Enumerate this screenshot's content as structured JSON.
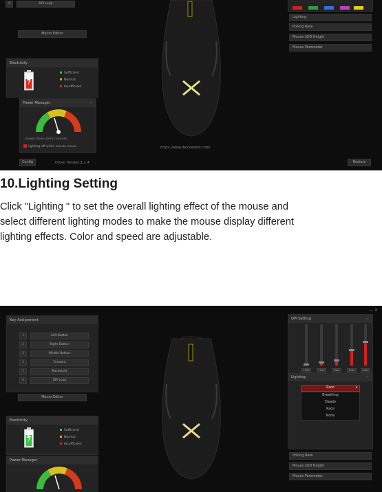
{
  "shot1": {
    "key_row": {
      "num": "6",
      "label": "DPI Loop"
    },
    "macro_editor": "Macro Editor",
    "electricity": {
      "title": "Electricity",
      "legend": [
        {
          "label": "Sufficient",
          "color": "#2ecc40"
        },
        {
          "label": "Normal",
          "color": "#e8a010"
        },
        {
          "label": "Insufficient",
          "color": "#e02020"
        }
      ]
    },
    "power_manager": {
      "title": "Power Manager",
      "minus": "—",
      "power_down": "power down (ten) minutes",
      "lighting_off": "lighting off while mouse move"
    },
    "footer": {
      "config": "Config",
      "driver_version": "Driver Version:1.1.4",
      "url": "https://www.delcoworld.com/",
      "restore": "Restore"
    },
    "right_panel": {
      "swatches": [
        "#d42020",
        "#2ea03a",
        "#3070e0",
        "#c040c0",
        "#e0d020"
      ],
      "items": [
        "Lighting",
        "Polling Rate",
        "Mouse LOD Height",
        "Mouse Parameter"
      ]
    }
  },
  "doc": {
    "title": "10.Lighting Setting",
    "line1": "Click \"Lighting \" to set the overall lighting effect of the mouse and",
    "line2": "select different lighting modes to make the mouse display different",
    "line3": "lighting effects. Color and speed are adjustable."
  },
  "shot2": {
    "window_controls": "— ✕",
    "key_assignment": {
      "title": "Key Assignment",
      "rows": [
        {
          "num": "1",
          "label": "Left Button"
        },
        {
          "num": "2",
          "label": "Right Button"
        },
        {
          "num": "3",
          "label": "Middle Button"
        },
        {
          "num": "4",
          "label": "Forward"
        },
        {
          "num": "5",
          "label": "Backward"
        },
        {
          "num": "6",
          "label": "DPI Loop"
        }
      ]
    },
    "macro_editor": "Macro Editor",
    "electricity": {
      "title": "Electricity",
      "legend": [
        {
          "label": "Sufficient",
          "color": "#2ecc40"
        },
        {
          "label": "Normal",
          "color": "#e8a010"
        },
        {
          "label": "Insufficient",
          "color": "#e02020"
        }
      ]
    },
    "power_manager": {
      "title": "Power Manager"
    },
    "dpi_setting": {
      "title": "DPI Setting",
      "minus": "—",
      "values": [
        "1000",
        "1500",
        "2400",
        "3200",
        "5000"
      ],
      "levels": [
        0.0,
        0.05,
        0.1,
        0.35,
        0.55
      ],
      "colors": [
        "#d42020",
        "#2ea03a",
        "#3070e0",
        "#c040c0",
        "#e0d020"
      ]
    },
    "lighting": {
      "title": "Lighting",
      "minus": "—",
      "selected": "Race",
      "chevron": "▾",
      "options": [
        "Breathing",
        "Steady",
        "Race",
        "None"
      ]
    },
    "bottom_items": [
      "Polling Rate",
      "Mouse LOD Height",
      "Mouse Parameter"
    ]
  }
}
